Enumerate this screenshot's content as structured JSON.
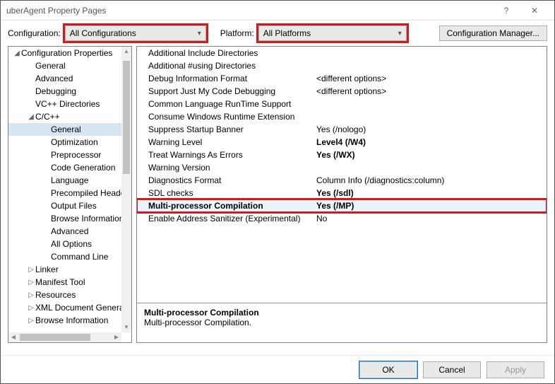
{
  "title": "uberAgent Property Pages",
  "toolbar": {
    "config_label": "Configuration:",
    "config_value": "All Configurations",
    "platform_label": "Platform:",
    "platform_value": "All Platforms",
    "manager_label": "Configuration Manager..."
  },
  "tree": {
    "root": "Configuration Properties",
    "general": "General",
    "advanced": "Advanced",
    "debugging": "Debugging",
    "vcdirs": "VC++ Directories",
    "cpp": "C/C++",
    "cpp_general": "General",
    "cpp_opt": "Optimization",
    "cpp_prep": "Preprocessor",
    "cpp_codegen": "Code Generation",
    "cpp_lang": "Language",
    "cpp_pch": "Precompiled Heade",
    "cpp_out": "Output Files",
    "cpp_browse": "Browse Information",
    "cpp_adv": "Advanced",
    "cpp_allopt": "All Options",
    "cpp_cmd": "Command Line",
    "linker": "Linker",
    "manifest": "Manifest Tool",
    "resources": "Resources",
    "xmldoc": "XML Document Genera",
    "browseinfo": "Browse Information"
  },
  "grid": {
    "rows": [
      {
        "name": "Additional Include Directories",
        "value": ""
      },
      {
        "name": "Additional #using Directories",
        "value": ""
      },
      {
        "name": "Debug Information Format",
        "value": "<different options>"
      },
      {
        "name": "Support Just My Code Debugging",
        "value": "<different options>"
      },
      {
        "name": "Common Language RunTime Support",
        "value": ""
      },
      {
        "name": "Consume Windows Runtime Extension",
        "value": ""
      },
      {
        "name": "Suppress Startup Banner",
        "value": "Yes (/nologo)"
      },
      {
        "name": "Warning Level",
        "value": "Level4 (/W4)",
        "bold": true
      },
      {
        "name": "Treat Warnings As Errors",
        "value": "Yes (/WX)",
        "bold": true
      },
      {
        "name": "Warning Version",
        "value": ""
      },
      {
        "name": "Diagnostics Format",
        "value": "Column Info (/diagnostics:column)"
      },
      {
        "name": "SDL checks",
        "value": "Yes (/sdl)",
        "bold": true
      },
      {
        "name": "Multi-processor Compilation",
        "value": "Yes (/MP)",
        "highlight": true
      },
      {
        "name": "Enable Address Sanitizer (Experimental)",
        "value": "No"
      }
    ]
  },
  "desc": {
    "title": "Multi-processor Compilation",
    "body": "Multi-processor Compilation."
  },
  "footer": {
    "ok": "OK",
    "cancel": "Cancel",
    "apply": "Apply"
  }
}
